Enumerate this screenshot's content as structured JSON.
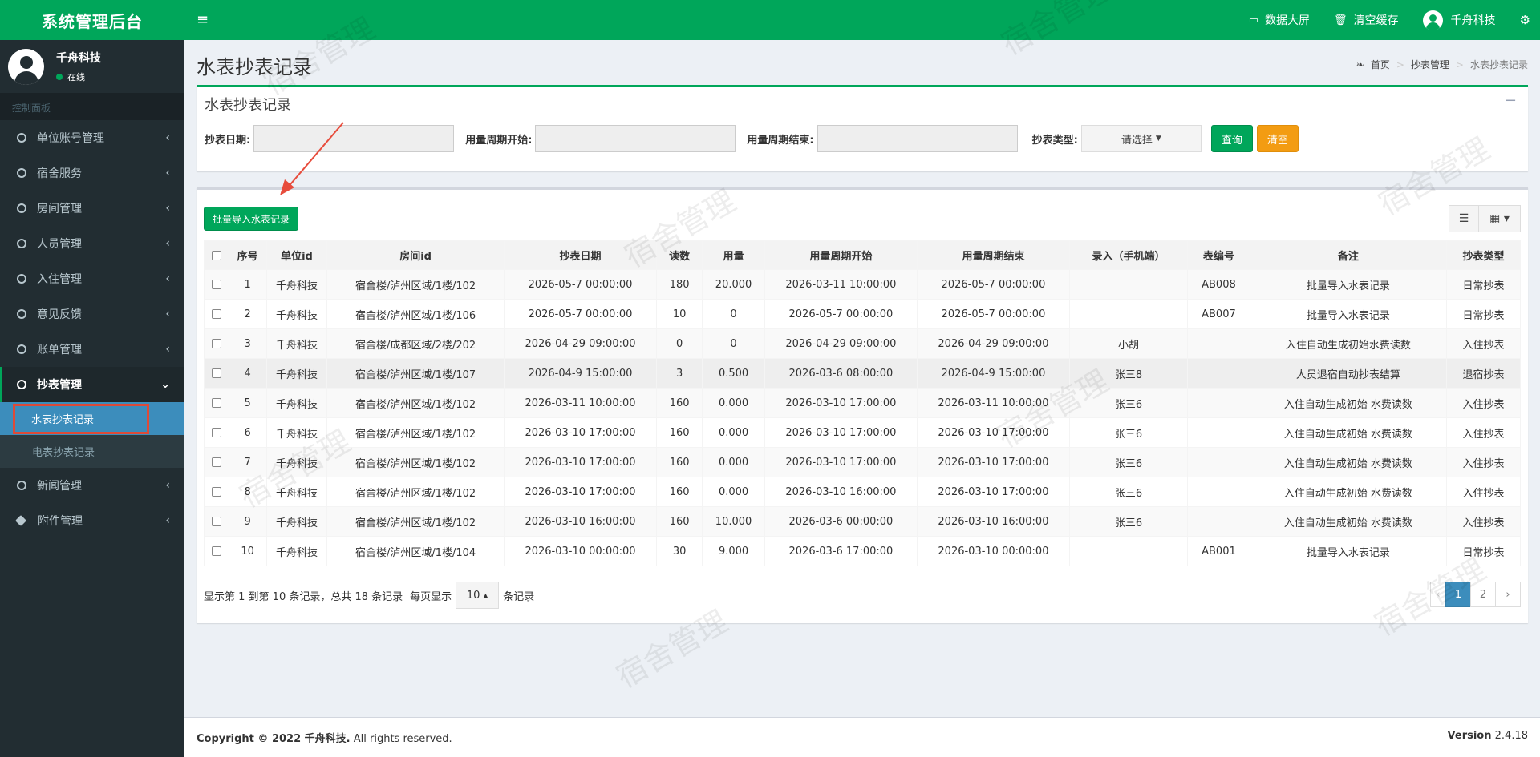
{
  "sidebar": {
    "logo": "系统管理后台",
    "user": {
      "name": "千舟科技",
      "status": "在线"
    },
    "menu_header": "控制面板",
    "items": [
      {
        "label": "单位账号管理",
        "icon": "circle-icon"
      },
      {
        "label": "宿舍服务",
        "icon": "circle-icon"
      },
      {
        "label": "房间管理",
        "icon": "circle-icon"
      },
      {
        "label": "人员管理",
        "icon": "circle-icon"
      },
      {
        "label": "入住管理",
        "icon": "circle-icon"
      },
      {
        "label": "意见反馈",
        "icon": "circle-icon"
      },
      {
        "label": "账单管理",
        "icon": "circle-icon"
      },
      {
        "label": "抄表管理",
        "icon": "circle-icon"
      },
      {
        "label": "新闻管理",
        "icon": "circle-icon"
      },
      {
        "label": "附件管理",
        "icon": "tags-icon"
      }
    ],
    "submenu": [
      {
        "label": "水表抄表记录"
      },
      {
        "label": "电表抄表记录"
      }
    ]
  },
  "header": {
    "menu_toggle": "≡",
    "data_screen": "数据大屏",
    "clear_cache": "清空缓存",
    "user_name": "千舟科技"
  },
  "page": {
    "title": "水表抄表记录",
    "breadcrumb": [
      "首页",
      "抄表管理",
      "水表抄表记录"
    ]
  },
  "search_box": {
    "title": "水表抄表记录",
    "collapse": "−",
    "fields": {
      "date_label": "抄表日期:",
      "period_start_label": "用量周期开始:",
      "period_end_label": "用量周期结束:",
      "type_label": "抄表类型:",
      "type_placeholder": "请选择"
    },
    "query_button": "查询",
    "clear_button": "清空"
  },
  "table_box": {
    "import_button": "批量导入水表记录",
    "columns": [
      "序号",
      "单位id",
      "房间id",
      "抄表日期",
      "读数",
      "用量",
      "用量周期开始",
      "用量周期结束",
      "录入（手机端）",
      "表编号",
      "备注",
      "抄表类型"
    ],
    "rows": [
      [
        "1",
        "千舟科技",
        "宿舍楼/泸州区域/1楼/102",
        "2026-05-7 00:00:00",
        "180",
        "20.000",
        "2026-03-11 10:00:00",
        "2026-05-7 00:00:00",
        "",
        "AB008",
        "批量导入水表记录",
        "日常抄表"
      ],
      [
        "2",
        "千舟科技",
        "宿舍楼/泸州区域/1楼/106",
        "2026-05-7 00:00:00",
        "10",
        "0",
        "2026-05-7 00:00:00",
        "2026-05-7 00:00:00",
        "",
        "AB007",
        "批量导入水表记录",
        "日常抄表"
      ],
      [
        "3",
        "千舟科技",
        "宿舍楼/成都区域/2楼/202",
        "2026-04-29 09:00:00",
        "0",
        "0",
        "2026-04-29 09:00:00",
        "2026-04-29 09:00:00",
        "小胡",
        "",
        "入住自动生成初始水费读数",
        "入住抄表"
      ],
      [
        "4",
        "千舟科技",
        "宿舍楼/泸州区域/1楼/107",
        "2026-04-9 15:00:00",
        "3",
        "0.500",
        "2026-03-6 08:00:00",
        "2026-04-9 15:00:00",
        "张三8",
        "",
        "人员退宿自动抄表结算",
        "退宿抄表"
      ],
      [
        "5",
        "千舟科技",
        "宿舍楼/泸州区域/1楼/102",
        "2026-03-11 10:00:00",
        "160",
        "0.000",
        "2026-03-10 17:00:00",
        "2026-03-11 10:00:00",
        "张三6",
        "",
        "入住自动生成初始 水费读数",
        "入住抄表"
      ],
      [
        "6",
        "千舟科技",
        "宿舍楼/泸州区域/1楼/102",
        "2026-03-10 17:00:00",
        "160",
        "0.000",
        "2026-03-10 17:00:00",
        "2026-03-10 17:00:00",
        "张三6",
        "",
        "入住自动生成初始 水费读数",
        "入住抄表"
      ],
      [
        "7",
        "千舟科技",
        "宿舍楼/泸州区域/1楼/102",
        "2026-03-10 17:00:00",
        "160",
        "0.000",
        "2026-03-10 17:00:00",
        "2026-03-10 17:00:00",
        "张三6",
        "",
        "入住自动生成初始 水费读数",
        "入住抄表"
      ],
      [
        "8",
        "千舟科技",
        "宿舍楼/泸州区域/1楼/102",
        "2026-03-10 17:00:00",
        "160",
        "0.000",
        "2026-03-10 16:00:00",
        "2026-03-10 17:00:00",
        "张三6",
        "",
        "入住自动生成初始 水费读数",
        "入住抄表"
      ],
      [
        "9",
        "千舟科技",
        "宿舍楼/泸州区域/1楼/102",
        "2026-03-10 16:00:00",
        "160",
        "10.000",
        "2026-03-6 00:00:00",
        "2026-03-10 16:00:00",
        "张三6",
        "",
        "入住自动生成初始 水费读数",
        "入住抄表"
      ],
      [
        "10",
        "千舟科技",
        "宿舍楼/泸州区域/1楼/104",
        "2026-03-10 00:00:00",
        "30",
        "9.000",
        "2026-03-6 17:00:00",
        "2026-03-10 00:00:00",
        "",
        "AB001",
        "批量导入水表记录",
        "日常抄表"
      ]
    ],
    "pager_info": "显示第 1 到第 10 条记录，总共 18 条记录",
    "per_page_prefix": "每页显示",
    "per_page": "10",
    "per_page_suffix": "条记录",
    "pages": [
      "‹",
      "1",
      "2",
      "›"
    ]
  },
  "footer": {
    "copyright_prefix": "Copyright © 2022 ",
    "company": "千舟科技.",
    "rights": " All rights reserved.",
    "version_label": "Version",
    "version": "2.4.18"
  },
  "watermark": "宿舍管理",
  "colors": {
    "primary": "#00a65a",
    "sidebar": "#222d32",
    "accent_blue": "#3c8dbc",
    "orange": "#f39c12",
    "highlight_red": "#dd4b39"
  }
}
